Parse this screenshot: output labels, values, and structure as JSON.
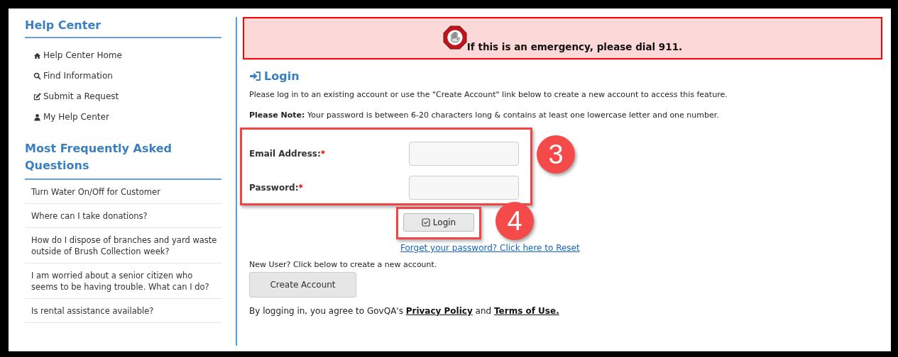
{
  "sidebar": {
    "title": "Help Center",
    "items": [
      {
        "label": "Help Center Home"
      },
      {
        "label": "Find Information"
      },
      {
        "label": "Submit a Request"
      },
      {
        "label": "My Help Center"
      }
    ],
    "faq_title": "Most Frequently Asked Questions",
    "faq": [
      "Turn Water On/Off for Customer",
      "Where can I take donations?",
      "How do I dispose of branches and yard waste outside of Brush Collection week?",
      "I am worried about a senior citizen who seems to be having trouble. What can I do?",
      "Is rental assistance available?"
    ]
  },
  "alert": {
    "text": "If this is an emergency, please dial 911."
  },
  "login": {
    "title": "Login",
    "intro": "Please log in to an existing account or use the \"Create Account\" link below to create a new account to access this feature.",
    "note": "**Please Note:** Your password is between 6-20 characters long & contains at least one lowercase letter and one number.",
    "fields": [
      {
        "label": "Email Address:",
        "required": true
      },
      {
        "label": "Password:",
        "required": true
      }
    ],
    "required_mark": "*",
    "button": "Login",
    "forgot_link": "Forget your password? Click here to Reset",
    "new_user": "New User? Click below to create a new account.",
    "create_button": "Create Account",
    "terms": {
      "prefix": "By logging in, you agree to GovQA's",
      "link_1": "Privacy Policy",
      "middle": "and",
      "link_2": "Terms of Use."
    }
  },
  "callouts": [
    "3",
    "4"
  ]
}
